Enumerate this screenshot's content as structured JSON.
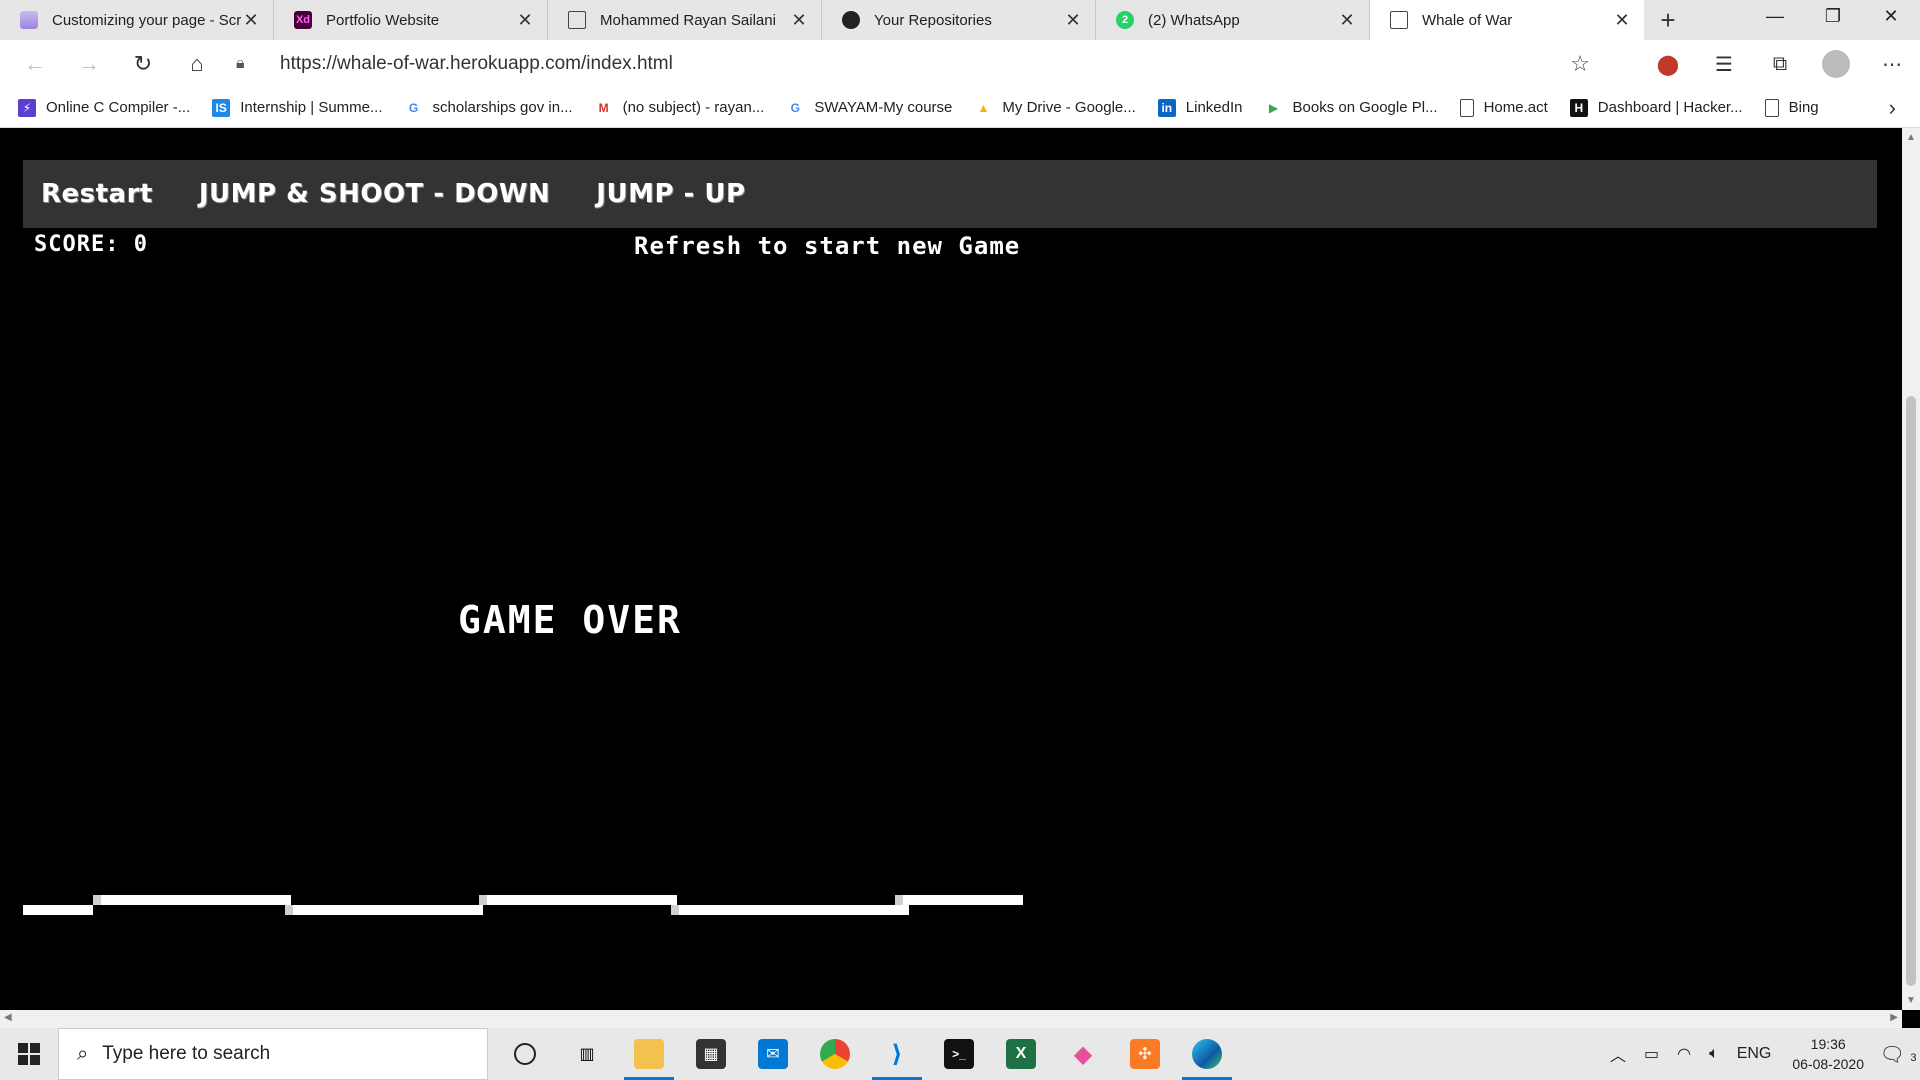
{
  "browser": {
    "tabs": [
      {
        "title": "Customizing your page - Scr",
        "icon": "scribd-icon"
      },
      {
        "title": "Portfolio Website",
        "icon": "xd-icon"
      },
      {
        "title": "Mohammed Rayan Sailani",
        "icon": "page-icon"
      },
      {
        "title": "Your Repositories",
        "icon": "github-icon"
      },
      {
        "title": "(2) WhatsApp",
        "icon": "whatsapp-icon",
        "badge": "2"
      },
      {
        "title": "Whale of War",
        "icon": "page-icon",
        "active": true
      }
    ],
    "url": "https://whale-of-war.herokuapp.com/index.html",
    "bookmarks": [
      {
        "label": "Online C Compiler -...",
        "icon": "bolt-icon"
      },
      {
        "label": "Internship | Summe...",
        "icon": "is-icon"
      },
      {
        "label": "scholarships gov in...",
        "icon": "google-icon"
      },
      {
        "label": "(no subject) - rayan...",
        "icon": "gmail-icon"
      },
      {
        "label": "SWAYAM-My course",
        "icon": "google-icon"
      },
      {
        "label": "My Drive - Google...",
        "icon": "drive-icon"
      },
      {
        "label": "LinkedIn",
        "icon": "linkedin-icon"
      },
      {
        "label": "Books on Google Pl...",
        "icon": "play-icon"
      },
      {
        "label": "Home.act",
        "icon": "page-icon"
      },
      {
        "label": "Dashboard | Hacker...",
        "icon": "hackerrank-icon"
      },
      {
        "label": "Bing",
        "icon": "page-icon"
      }
    ]
  },
  "game": {
    "menu": {
      "restart": "Restart",
      "jump_shoot": "JUMP & SHOOT - DOWN",
      "jump": "JUMP - UP"
    },
    "score_label": "SCORE: 0",
    "refresh_msg": "Refresh to start new Game",
    "game_over": "GAME OVER"
  },
  "taskbar": {
    "search_placeholder": "Type here to search",
    "language": "ENG",
    "time": "19:36",
    "date": "06-08-2020",
    "notification_count": "3"
  },
  "colors": {
    "game_bg": "#000000",
    "menu_bar": "#333333",
    "game_text": "#ffffff",
    "taskbar_accent": "#0078d4"
  }
}
